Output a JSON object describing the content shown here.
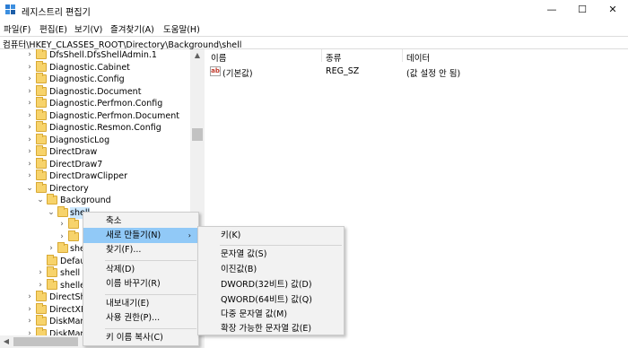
{
  "window": {
    "title": "레지스트리 편집기",
    "minimize": "—",
    "maximize": "☐",
    "close": "✕"
  },
  "menu": [
    "파일(F)",
    "편집(E)",
    "보기(V)",
    "즐겨찾기(A)",
    "도움말(H)"
  ],
  "address": "컴퓨터\\HKEY_CLASSES_ROOT\\Directory\\Background\\shell",
  "tree": [
    {
      "label": "DfsShell.DfsShellAdmin.1"
    },
    {
      "label": "Diagnostic.Cabinet"
    },
    {
      "label": "Diagnostic.Config"
    },
    {
      "label": "Diagnostic.Document"
    },
    {
      "label": "Diagnostic.Perfmon.Config"
    },
    {
      "label": "Diagnostic.Perfmon.Document"
    },
    {
      "label": "Diagnostic.Resmon.Config"
    },
    {
      "label": "DiagnosticLog"
    },
    {
      "label": "DirectDraw"
    },
    {
      "label": "DirectDraw7"
    },
    {
      "label": "DirectDrawClipper"
    },
    {
      "label": "Directory"
    },
    {
      "label": "Background"
    },
    {
      "label": "shell"
    },
    {
      "label": ""
    },
    {
      "label": ""
    },
    {
      "label": "she"
    },
    {
      "label": "Defau"
    },
    {
      "label": "shell"
    },
    {
      "label": "shellex"
    },
    {
      "label": "DirectSho"
    },
    {
      "label": "DirectXFil"
    },
    {
      "label": "DiskMan"
    },
    {
      "label": "DiskMan"
    }
  ],
  "list": {
    "headers": {
      "name": "이름",
      "type": "종류",
      "data": "데이터"
    },
    "rows": [
      {
        "icon": "ab",
        "name": "(기본값)",
        "type": "REG_SZ",
        "data": "(값 설정 안 됨)"
      }
    ]
  },
  "context_menu": {
    "items": [
      "축소",
      "새로 만들기(N)",
      "찾기(F)...",
      "삭제(D)",
      "이름 바꾸기(R)",
      "내보내기(E)",
      "사용 권한(P)...",
      "키 이름 복사(C)"
    ]
  },
  "submenu": {
    "items": [
      "키(K)",
      "문자열 값(S)",
      "이진값(B)",
      "DWORD(32비트) 값(D)",
      "QWORD(64비트) 값(Q)",
      "다중 문자열 값(M)",
      "확장 가능한 문자열 값(E)"
    ]
  },
  "colors": {
    "hover": "#91c9f7",
    "folder": "#f7d36b",
    "selection": "#cce8ff"
  }
}
